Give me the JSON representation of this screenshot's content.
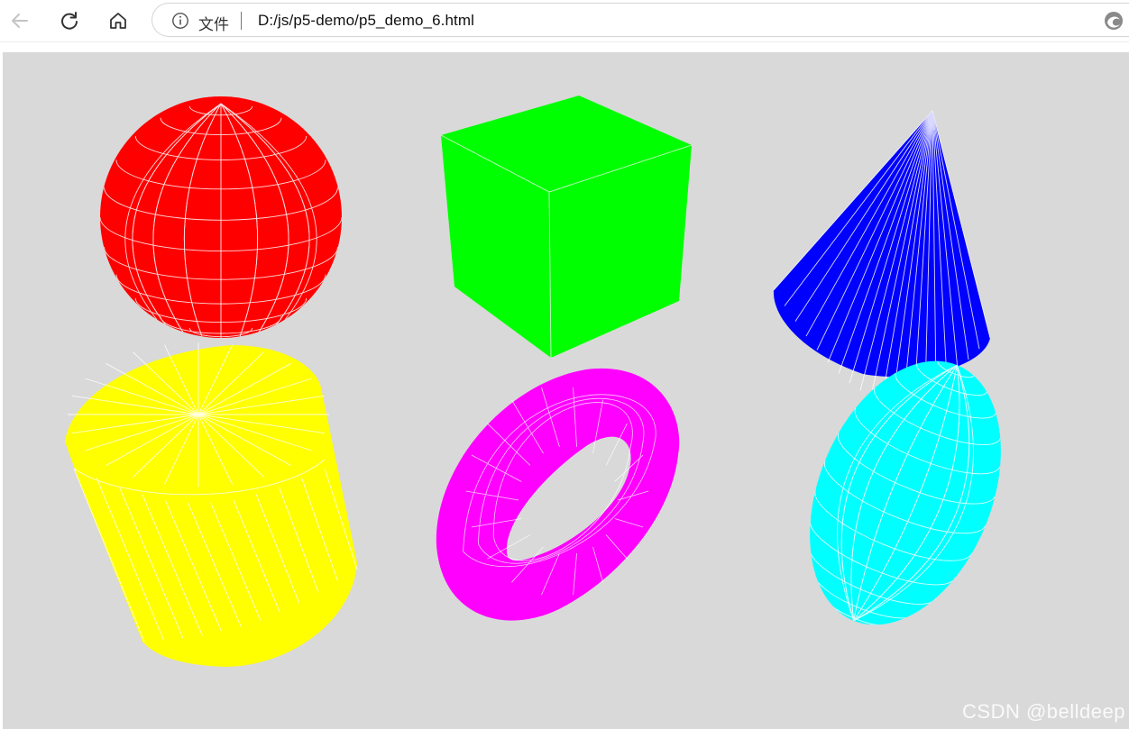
{
  "browser": {
    "address_label": "文件",
    "url": "D:/js/p5-demo/p5_demo_6.html"
  },
  "icons": {
    "back": "arrow-left-icon",
    "reload": "reload-icon",
    "home": "home-icon",
    "info": "info-icon",
    "profile": "edge-icon"
  },
  "scene": {
    "background": "#d9d9d9",
    "wireframe_color": "#ffffff",
    "shapes": [
      {
        "kind": "sphere",
        "color": "#ff0000"
      },
      {
        "kind": "box",
        "color": "#00ff00"
      },
      {
        "kind": "cone",
        "color": "#0000ff"
      },
      {
        "kind": "cylinder",
        "color": "#ffff00"
      },
      {
        "kind": "torus",
        "color": "#ff00ff"
      },
      {
        "kind": "ellipsoid",
        "color": "#00ffff"
      }
    ]
  },
  "watermark": "CSDN @belldeep"
}
